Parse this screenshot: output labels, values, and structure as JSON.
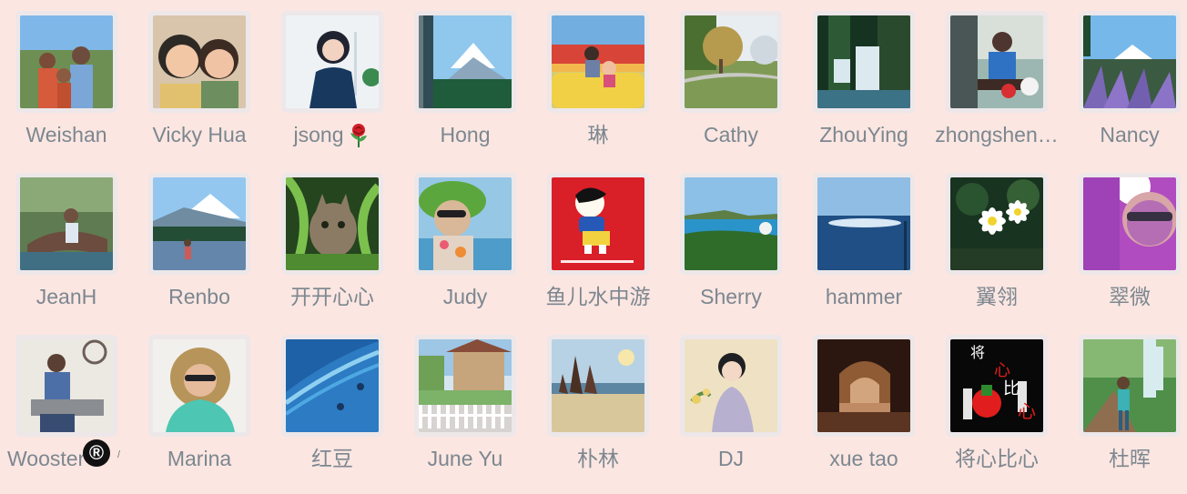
{
  "members": [
    {
      "name": "Weishan"
    },
    {
      "name": "Vicky Hua"
    },
    {
      "name": "jsong"
    },
    {
      "name": "Hong"
    },
    {
      "name": "琳"
    },
    {
      "name": "Cathy"
    },
    {
      "name": "ZhouYing"
    },
    {
      "name": "zhongshen…"
    },
    {
      "name": "Nancy"
    },
    {
      "name": "JeanH"
    },
    {
      "name": "Renbo"
    },
    {
      "name": "开开心心"
    },
    {
      "name": "Judy"
    },
    {
      "name": "鱼儿水中游"
    },
    {
      "name": "Sherry"
    },
    {
      "name": "hammer"
    },
    {
      "name": "翼翎"
    },
    {
      "name": "翠微"
    },
    {
      "name": "Wooster"
    },
    {
      "name": "Marina"
    },
    {
      "name": "红豆"
    },
    {
      "name": "June Yu"
    },
    {
      "name": "朴林"
    },
    {
      "name": "DJ"
    },
    {
      "name": "xue tao"
    },
    {
      "name": "将心比心"
    },
    {
      "name": "杜晖"
    }
  ],
  "wooster_badge": "®",
  "wooster_trail": "/",
  "thumbnail_text": {
    "xinbixin": [
      "将",
      "心",
      "比",
      "心"
    ]
  },
  "colors": {
    "background": "#fbe6e1",
    "name_text": "#7c8790"
  }
}
